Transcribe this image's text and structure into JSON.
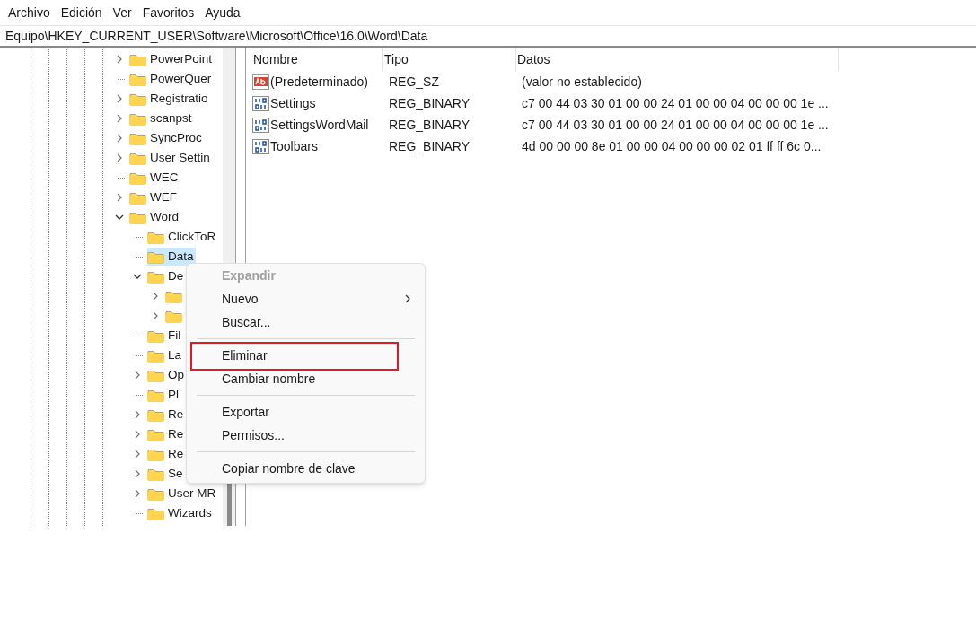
{
  "menu_bar": [
    "Archivo",
    "Edición",
    "Ver",
    "Favoritos",
    "Ayuda"
  ],
  "address": "Equipo\\HKEY_CURRENT_USER\\Software\\Microsoft\\Office\\16.0\\Word\\Data",
  "tree": [
    {
      "kind": "folder",
      "label": "PowerPoint",
      "expanded": false,
      "selected": false
    },
    {
      "kind": "leaf",
      "label": "PowerQuer",
      "selected": false
    },
    {
      "kind": "folder",
      "label": "Registratio",
      "expanded": false,
      "selected": false
    },
    {
      "kind": "folder",
      "label": "scanpst",
      "expanded": false,
      "selected": false
    },
    {
      "kind": "folder",
      "label": "SyncProc",
      "expanded": false,
      "selected": false
    },
    {
      "kind": "folder",
      "label": "User Settin",
      "expanded": false,
      "selected": false
    },
    {
      "kind": "leaf",
      "label": "WEC",
      "selected": false
    },
    {
      "kind": "folder",
      "label": "WEF",
      "expanded": false,
      "selected": false
    },
    {
      "kind": "folder",
      "label": "Word",
      "expanded": true,
      "selected": false,
      "children": [
        {
          "kind": "leaf",
          "label": "ClickToR",
          "selected": false
        },
        {
          "kind": "leaf",
          "label": "Data",
          "selected": true
        },
        {
          "kind": "folder",
          "label": "De",
          "expanded": true,
          "selected": false,
          "children": [
            {
              "kind": "folder",
              "expanded": false,
              "selected": false
            },
            {
              "kind": "folder",
              "expanded": false,
              "selected": false
            }
          ]
        },
        {
          "kind": "leaf",
          "label": "Fil",
          "selected": false
        },
        {
          "kind": "leaf",
          "label": "La",
          "selected": false
        },
        {
          "kind": "folder",
          "label": "Op",
          "expanded": false,
          "selected": false
        },
        {
          "kind": "leaf",
          "label": "Pl",
          "selected": false
        },
        {
          "kind": "folder",
          "label": "Re",
          "expanded": false,
          "selected": false
        },
        {
          "kind": "folder",
          "label": "Re",
          "expanded": false,
          "selected": false
        },
        {
          "kind": "folder",
          "label": "Re",
          "expanded": false,
          "selected": false
        },
        {
          "kind": "folder",
          "label": "Se",
          "expanded": false,
          "selected": false
        },
        {
          "kind": "folder",
          "label": "User MR",
          "expanded": false,
          "selected": false
        },
        {
          "kind": "leaf",
          "label": "Wizards",
          "selected": false
        }
      ]
    }
  ],
  "values_table": {
    "columns": [
      "Nombre",
      "Tipo",
      "Datos"
    ],
    "rows": [
      {
        "kind": "string",
        "name": "(Predeterminado)",
        "type": "REG_SZ",
        "data": "(valor no establecido)"
      },
      {
        "kind": "binary",
        "name": "Settings",
        "type": "REG_BINARY",
        "data": "c7 00 44 03 30 01 00 00 24 01 00 00 04 00 00 00 1e ..."
      },
      {
        "kind": "binary",
        "name": "SettingsWordMail",
        "type": "REG_BINARY",
        "data": "c7 00 44 03 30 01 00 00 24 01 00 00 04 00 00 00 1e ..."
      },
      {
        "kind": "binary",
        "name": "Toolbars",
        "type": "REG_BINARY",
        "data": "4d 00 00 00 8e 01 00 00 04 00 00 00 02 01 ff ff 6c 0..."
      }
    ]
  },
  "context_menu": [
    {
      "kind": "item",
      "label": "Expandir",
      "disabled": true,
      "submenu": false,
      "outlined": false
    },
    {
      "kind": "item",
      "label": "Nuevo",
      "disabled": false,
      "submenu": true,
      "outlined": false
    },
    {
      "kind": "item",
      "label": "Buscar...",
      "disabled": false,
      "submenu": false,
      "outlined": false
    },
    {
      "kind": "separator"
    },
    {
      "kind": "item",
      "label": "Eliminar",
      "disabled": false,
      "submenu": false,
      "outlined": true
    },
    {
      "kind": "item",
      "label": "Cambiar nombre",
      "disabled": false,
      "submenu": false,
      "outlined": false
    },
    {
      "kind": "separator"
    },
    {
      "kind": "item",
      "label": "Exportar",
      "disabled": false,
      "submenu": false,
      "outlined": false
    },
    {
      "kind": "item",
      "label": "Permisos...",
      "disabled": false,
      "submenu": false,
      "outlined": false
    },
    {
      "kind": "separator"
    },
    {
      "kind": "item",
      "label": "Copiar nombre de clave",
      "disabled": false,
      "submenu": false,
      "outlined": false
    }
  ]
}
